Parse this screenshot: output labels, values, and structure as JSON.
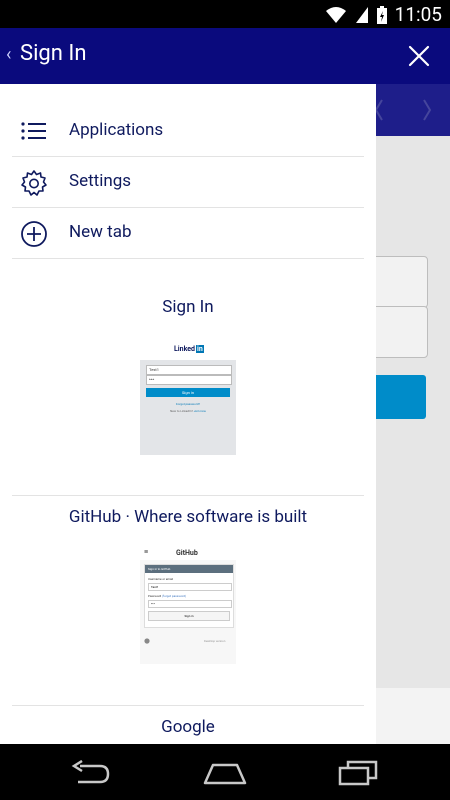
{
  "status_bar": {
    "time": "11:05"
  },
  "app_bar": {
    "title": "Sign In"
  },
  "menu": [
    {
      "label": "Applications",
      "icon": "list-icon"
    },
    {
      "label": "Settings",
      "icon": "gear-icon"
    },
    {
      "label": "New tab",
      "icon": "plus-circle-icon"
    }
  ],
  "tabs": [
    {
      "title": "Sign In",
      "thumbnail": {
        "brand": "Linked",
        "brand_badge": "in",
        "username_value": "Test1",
        "password_value": "***",
        "button_label": "Sign in",
        "forgot_text": "Forgot password?",
        "join_text": "New to LinkedIn?",
        "join_link": "Join now"
      }
    },
    {
      "title": "GitHub · Where software is built",
      "thumbnail": {
        "brand": "GitHub",
        "header": "Sign in to GitHub",
        "username_label": "Username or email",
        "username_value": "Test1",
        "password_label": "Password",
        "forgot_text": "(forgot password)",
        "password_value": "***",
        "button_label": "Sign in",
        "footer_link": "Desktop version"
      }
    },
    {
      "title": "Google"
    }
  ],
  "colors": {
    "app_bar": "#0a0a7d",
    "linkedin_blue": "#0077b5",
    "linkedin_button": "#008cc9"
  }
}
